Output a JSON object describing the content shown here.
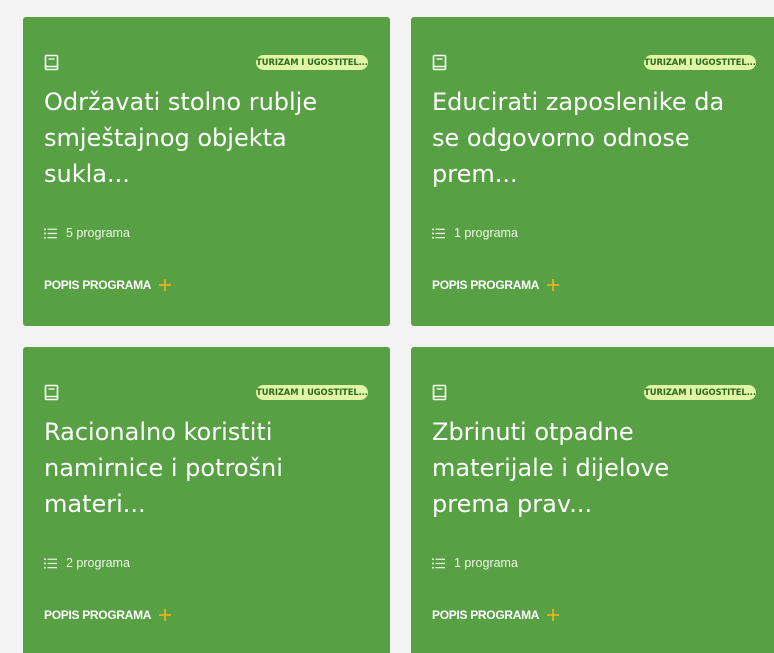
{
  "colors": {
    "card_background": "#57a044",
    "badge_background": "#e0f5a6",
    "badge_text": "#2f6b1e",
    "accent_plus": "#f5b51b",
    "page_background": "#f3f3f3"
  },
  "cards": [
    {
      "icon": "book-icon",
      "badge": "TURIZAM I UGOSTITEL...",
      "title": "Održavati stolno rublje\nsmještajnog objekta\nsukla...",
      "count_icon": "list-icon",
      "count": "5 programa",
      "link_label": "POPIS PROGRAMA",
      "link_icon": "plus-icon"
    },
    {
      "icon": "book-icon",
      "badge": "TURIZAM I UGOSTITEL...",
      "title": "Educirati zaposlenike da\nse odgovorno odnose\nprem...",
      "count_icon": "list-icon",
      "count": "1 programa",
      "link_label": "POPIS PROGRAMA",
      "link_icon": "plus-icon"
    },
    {
      "icon": "book-icon",
      "badge": "TURIZAM I UGOSTITEL...",
      "title": "Racionalno koristiti\nnamirnice i potrošni\nmateri...",
      "count_icon": "list-icon",
      "count": "2 programa",
      "link_label": "POPIS PROGRAMA",
      "link_icon": "plus-icon"
    },
    {
      "icon": "book-icon",
      "badge": "TURIZAM I UGOSTITEL...",
      "title": "Zbrinuti otpadne\nmaterijale i dijelove\nprema prav...",
      "count_icon": "list-icon",
      "count": "1 programa",
      "link_label": "POPIS PROGRAMA",
      "link_icon": "plus-icon"
    }
  ]
}
